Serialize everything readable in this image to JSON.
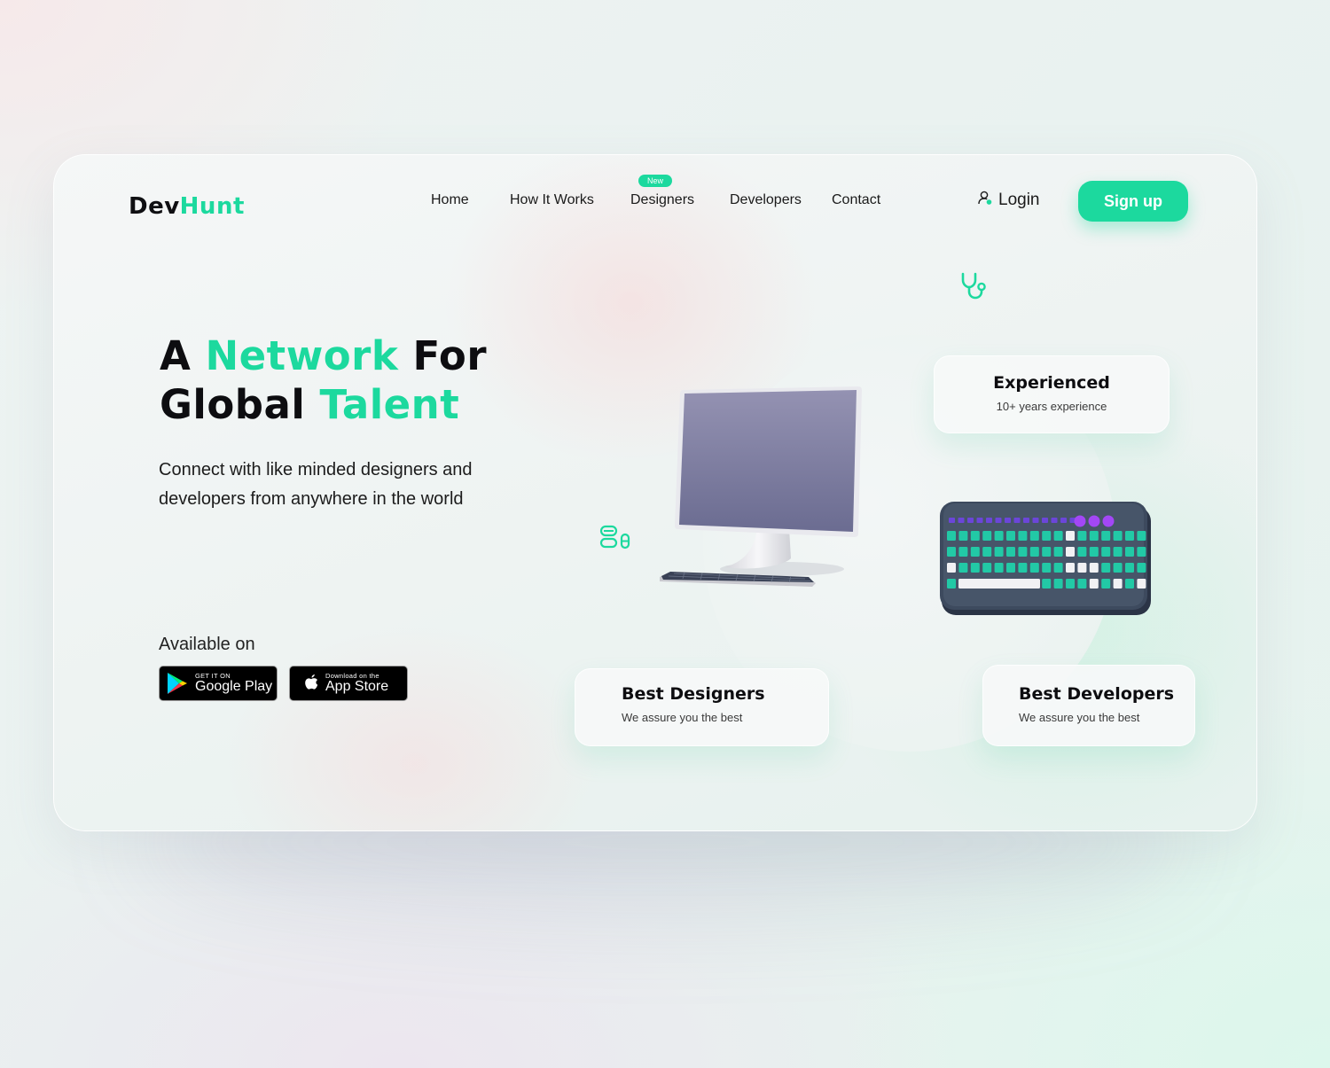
{
  "brand": {
    "part1": "Dev",
    "part2": "Hunt"
  },
  "nav": {
    "items": [
      "Home",
      "How It Works",
      "Designers",
      "Developers",
      "Contact"
    ],
    "new_badge": "New",
    "login": "Login",
    "signup": "Sign up"
  },
  "hero": {
    "title_a": "A",
    "title_network": "Network",
    "title_for": "For",
    "title_global": "Global",
    "title_talent": "Talent",
    "subtitle_line1": "Connect with like minded designers and",
    "subtitle_line2": "developers from anywhere in the world"
  },
  "available": {
    "label": "Available on",
    "google": {
      "small": "GET IT ON",
      "big": "Google Play"
    },
    "apple": {
      "small": "Download on the",
      "big": "App Store"
    }
  },
  "cards": {
    "experienced": {
      "title": "Experienced",
      "sub": "10+ years experience"
    },
    "designers": {
      "title": "Best Designers",
      "sub": "We assure you the best"
    },
    "developers": {
      "title": "Best Developers",
      "sub": "We assure you the best"
    }
  },
  "colors": {
    "accent": "#1cd99e",
    "text": "#0d0d10",
    "keyboard_body": "#3b4659",
    "monitor_screen": "#7c7c9e"
  },
  "icons": [
    "stethoscope-icon",
    "pills-icon",
    "user-icon",
    "google-play-icon",
    "apple-icon"
  ]
}
